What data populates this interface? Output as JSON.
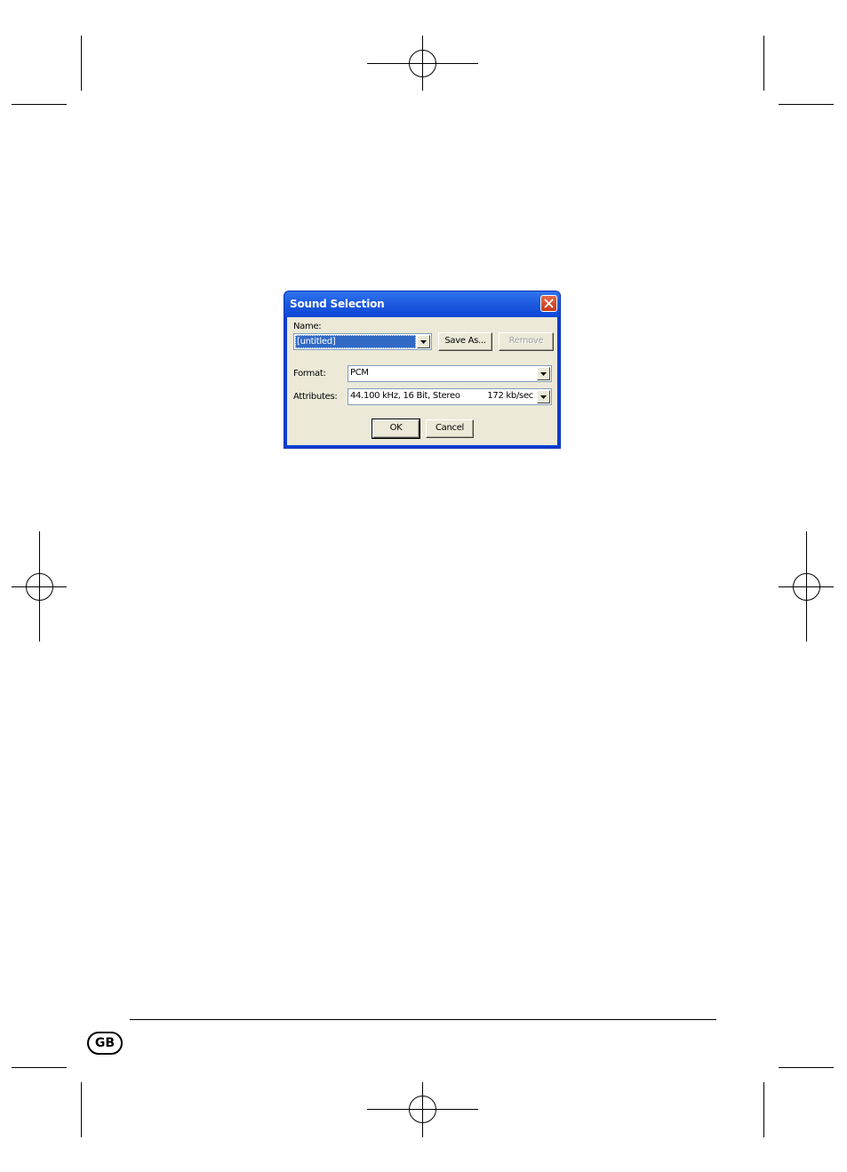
{
  "dialog": {
    "title": "Sound Selection",
    "name_label": "Name:",
    "name_value": "[untitled]",
    "save_as_label": "Save As...",
    "remove_label": "Remove",
    "format_label": "Format:",
    "format_value": "PCM",
    "attributes_label": "Attributes:",
    "attributes_value": "44.100 kHz, 16 Bit, Stereo",
    "attributes_rate": "172 kb/sec",
    "ok_label": "OK",
    "cancel_label": "Cancel"
  },
  "footer": {
    "language_badge": "GB"
  },
  "icons": {
    "close": "close-icon",
    "dropdown": "chevron-down-icon"
  },
  "colors": {
    "titlebar": "#1e5be0",
    "dialog_face": "#ece9d8",
    "close_button": "#d44c2c",
    "selection": "#316ac5"
  }
}
